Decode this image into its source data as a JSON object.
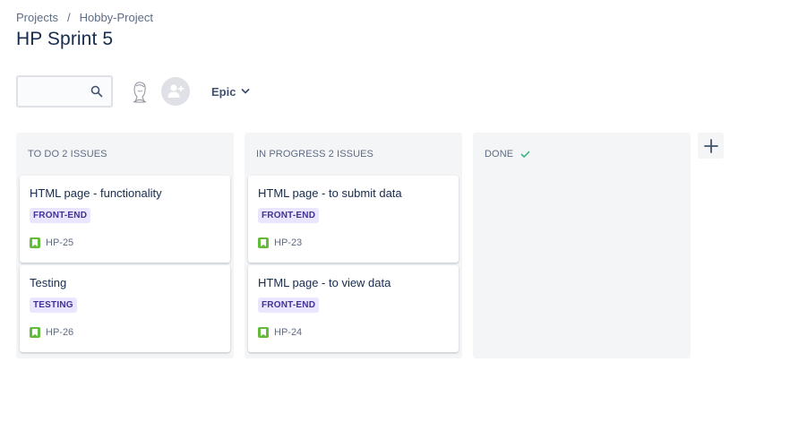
{
  "breadcrumb": {
    "projects": "Projects",
    "separator": "/",
    "project": "Hobby-Project"
  },
  "page": {
    "title": "HP Sprint 5"
  },
  "toolbar": {
    "search_value": "",
    "epic_label": "Epic"
  },
  "columns": [
    {
      "title": "TO DO 2 ISSUES",
      "cards": [
        {
          "title": "HTML page - functionality",
          "tag": "FRONT-END",
          "key": "HP-25"
        },
        {
          "title": "Testing",
          "tag": "TESTING",
          "key": "HP-26"
        }
      ]
    },
    {
      "title": "IN PROGRESS 2 ISSUES",
      "cards": [
        {
          "title": "HTML page - to submit data",
          "tag": "FRONT-END",
          "key": "HP-23"
        },
        {
          "title": "HTML page - to view data",
          "tag": "FRONT-END",
          "key": "HP-24"
        }
      ]
    },
    {
      "title": "DONE",
      "cards": []
    }
  ],
  "icons": {
    "search": "search-icon",
    "add_people": "add-person-icon",
    "chevron": "chevron-down-icon",
    "done_check": "check-icon",
    "story": "story-icon",
    "add_column": "plus-icon"
  },
  "colors": {
    "text_primary": "#172b4d",
    "text_secondary": "#5e6c84",
    "column_bg": "#f4f5f7",
    "tag_bg": "#eae6ff",
    "tag_text": "#403294",
    "story_green": "#63ba3c",
    "done_check": "#36b37e"
  }
}
